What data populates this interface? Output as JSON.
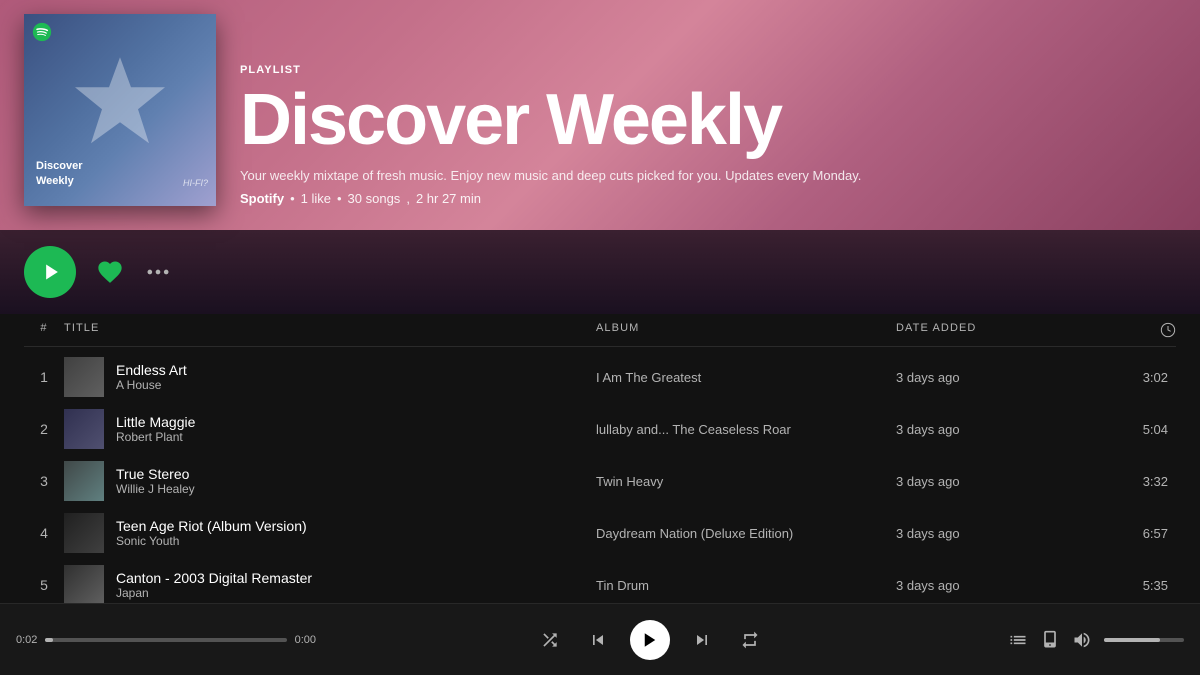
{
  "header": {
    "playlist_label": "PLAYLIST",
    "title": "Discover Weekly",
    "description": "Your weekly mixtape of fresh music. Enjoy new music and deep cuts picked for you. Updates every Monday.",
    "curator": "Spotify",
    "likes": "1 like",
    "songs": "30 songs",
    "duration": "2 hr 27 min"
  },
  "controls": {
    "play_label": "Play",
    "like_label": "Like",
    "more_label": "More options"
  },
  "table": {
    "col_num": "#",
    "col_title": "TITLE",
    "col_album": "ALBUM",
    "col_date": "DATE ADDED",
    "col_duration": "⏱"
  },
  "tracks": [
    {
      "num": "1",
      "name": "Endless Art",
      "artist": "A House",
      "album": "I Am The Greatest",
      "date": "3 days ago",
      "duration": "3:02"
    },
    {
      "num": "2",
      "name": "Little Maggie",
      "artist": "Robert Plant",
      "album": "lullaby and... The Ceaseless Roar",
      "date": "3 days ago",
      "duration": "5:04"
    },
    {
      "num": "3",
      "name": "True Stereo",
      "artist": "Willie J Healey",
      "album": "Twin Heavy",
      "date": "3 days ago",
      "duration": "3:32"
    },
    {
      "num": "4",
      "name": "Teen Age Riot (Album Version)",
      "artist": "Sonic Youth",
      "album": "Daydream Nation (Deluxe Edition)",
      "date": "3 days ago",
      "duration": "6:57"
    },
    {
      "num": "5",
      "name": "Canton - 2003 Digital Remaster",
      "artist": "Japan",
      "album": "Tin Drum",
      "date": "3 days ago",
      "duration": "5:35"
    }
  ],
  "player": {
    "current_time": "0:02",
    "total_time": "0:00",
    "progress_pct": 3,
    "volume_pct": 70
  }
}
